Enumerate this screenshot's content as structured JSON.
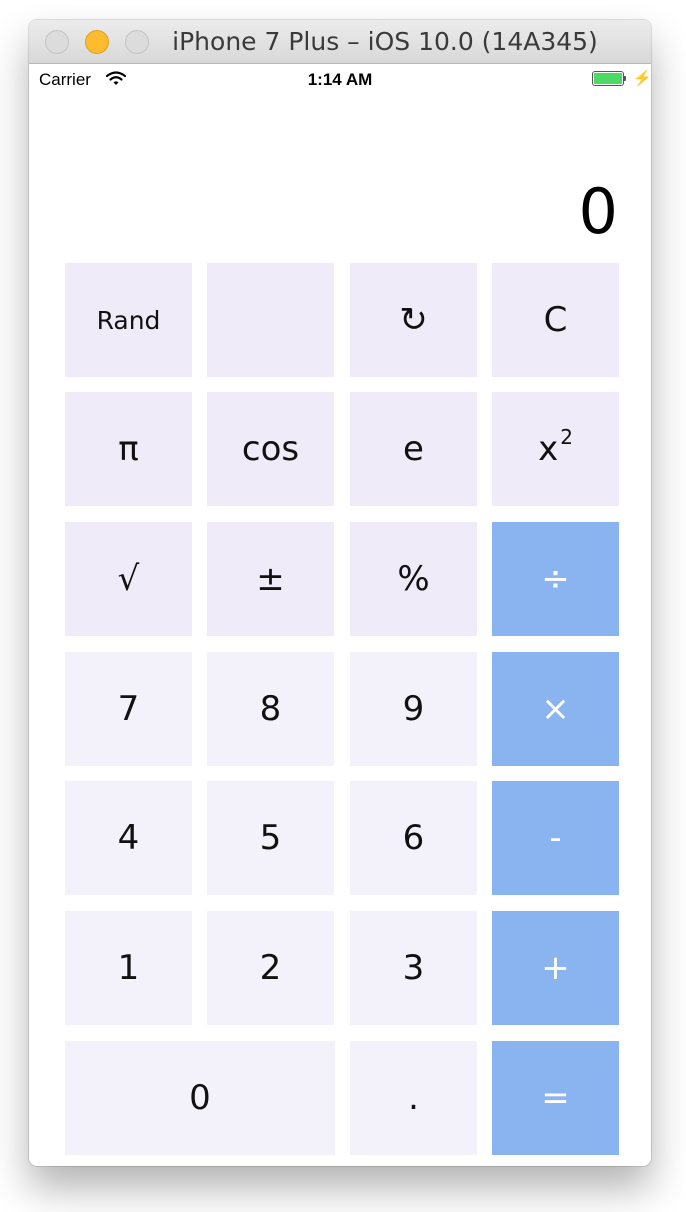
{
  "window": {
    "title": "iPhone 7 Plus – iOS 10.0 (14A345)"
  },
  "status_bar": {
    "carrier": "Carrier",
    "time": "1:14 AM",
    "battery_level": 1.0,
    "battery_color": "#4cd964"
  },
  "display": {
    "value": "0"
  },
  "keys": {
    "rand": "Rand",
    "blank": "",
    "undo": "↻",
    "clear": "C",
    "pi": "π",
    "cos": "cos",
    "e": "e",
    "square_base": "x",
    "square_exp": "2",
    "sqrt": "√",
    "plus_minus": "±",
    "percent": "%",
    "divide": "÷",
    "seven": "7",
    "eight": "8",
    "nine": "9",
    "multiply": "×",
    "four": "4",
    "five": "5",
    "six": "6",
    "subtract": "-",
    "one": "1",
    "two": "2",
    "three": "3",
    "add": "+",
    "zero": "0",
    "decimal": ".",
    "equals": "="
  },
  "colors": {
    "function_key": "#efebf8",
    "number_key": "#f3f2fb",
    "operator_key": "#8ab4f0"
  }
}
